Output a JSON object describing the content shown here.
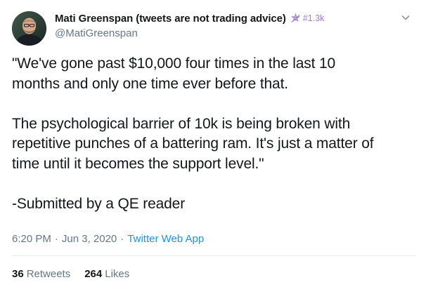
{
  "author": {
    "display_name": "Mati Greenspan (tweets are not trading advice)",
    "badge_text": "#1.3k",
    "handle": "@MatiGreenspan"
  },
  "tweet": {
    "lines_paragraph_1": [
      "\"We've gone past $10,000 four times in the last 10",
      "months and only one time ever before that."
    ],
    "lines_paragraph_2": [
      "The psychological barrier of 10k is being broken with",
      "repetitive punches of a battering ram. It's just a matter of",
      "time until it becomes the support level.\""
    ],
    "lines_paragraph_3": [
      "-Submitted by a QE reader"
    ]
  },
  "meta": {
    "time": "6:20 PM",
    "separator": "·",
    "date": "Jun 3, 2020",
    "source": "Twitter Web App"
  },
  "stats": {
    "retweets_count": "36",
    "retweets_label": "Retweets",
    "likes_count": "264",
    "likes_label": "Likes"
  },
  "colors": {
    "text": "#14171a",
    "secondary": "#657786",
    "link": "#1b95e0",
    "badge": "#a07cd8",
    "divider": "#e6ecf0"
  },
  "icons": {
    "badge": "crypto-badge-icon",
    "menu": "chevron-down-icon"
  }
}
